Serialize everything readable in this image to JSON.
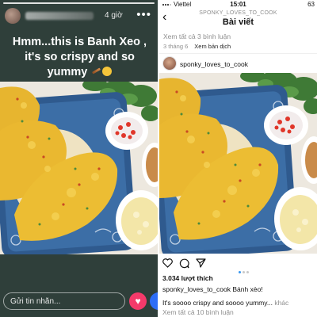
{
  "story": {
    "time": "4 giờ",
    "more_icon": "more-horizontal-icon",
    "caption": "Hmm...this is Banh Xeo , it's so crispy and so yummy",
    "reply_placeholder": "Gửi tin nhắn...",
    "heart_icon": "heart-icon"
  },
  "status_bar": {
    "carrier": "Viettel",
    "time": "15:01",
    "battery": "63"
  },
  "post": {
    "nav_username": "SPONKY_LOVES_TO_COOK",
    "nav_title": "Bài viết",
    "view_all_top": "Xem tất cả 3 bình luận",
    "date": "3 tháng 6",
    "translate": "Xem bản dịch",
    "username": "sponky_loves_to_cook",
    "likes": "3.034 lượt thích",
    "caption_user": "sponky_loves_to_cook",
    "caption_text": "Bánh xèo!",
    "comment_text": "It's soooo crispy and soooo yummy...",
    "comment_more": "khác",
    "view_all_bottom": "Xem tất cả 10 bình luận"
  },
  "colors": {
    "story_bg": "#2f3f3a",
    "heart_button": "#f43a6a",
    "carousel_active_dot": "#3897f0",
    "muted_text": "#8e8e8e"
  }
}
